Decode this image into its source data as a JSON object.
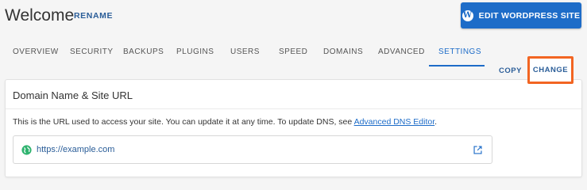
{
  "header": {
    "site_name": "Welcome",
    "rename_label": "RENAME",
    "edit_button_label": "EDIT WORDPRESS SITE",
    "edit_button_icon": "wordpress-icon"
  },
  "tabs": [
    {
      "label": "OVERVIEW",
      "active": false
    },
    {
      "label": "SECURITY",
      "active": false
    },
    {
      "label": "BACKUPS",
      "active": false
    },
    {
      "label": "PLUGINS",
      "active": false
    },
    {
      "label": "USERS",
      "active": false
    },
    {
      "label": "SPEED",
      "active": false
    },
    {
      "label": "DOMAINS",
      "active": false
    },
    {
      "label": "ADVANCED",
      "active": false
    },
    {
      "label": "SETTINGS",
      "active": true
    }
  ],
  "card": {
    "title": "Domain Name & Site URL",
    "description": "This is the URL used to access your site. You can update it at any time. To update DNS, see ",
    "dns_link_label": "Advanced DNS Editor",
    "description_end": ".",
    "url_value": "https://example.com",
    "url_icon": "globe-icon",
    "open_icon": "external-link-icon",
    "copy_label": "COPY",
    "change_label": "CHANGE"
  },
  "colors": {
    "accent": "#1d6cc8",
    "link": "#2a5d98",
    "highlight": "#f26522",
    "globe": "#2fb36f"
  }
}
